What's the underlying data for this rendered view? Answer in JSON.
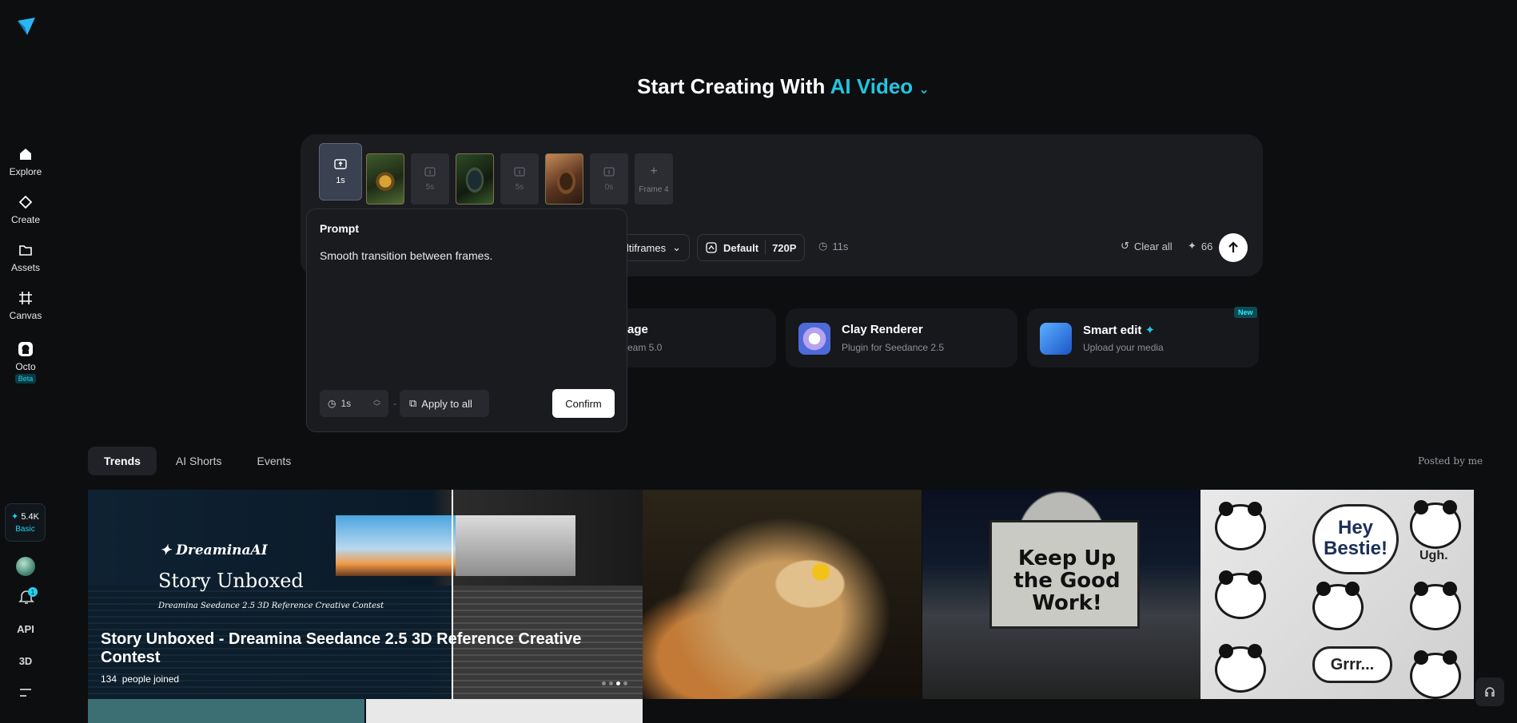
{
  "sidebar": {
    "items": [
      {
        "label": "Explore",
        "icon": "home-icon"
      },
      {
        "label": "Create",
        "icon": "diamond-icon"
      },
      {
        "label": "Assets",
        "icon": "folder-icon"
      },
      {
        "label": "Canvas",
        "icon": "canvas-icon"
      },
      {
        "label": "Octo",
        "icon": "octo-icon",
        "badge": "Beta"
      }
    ],
    "credits": "5.4K",
    "plan": "Basic",
    "notification_count": "1",
    "api_label": "API",
    "three_d_label": "3D"
  },
  "heading": {
    "prefix": "Start Creating With",
    "mode": "AI Video"
  },
  "frames": [
    {
      "label": "1s",
      "type": "active"
    },
    {
      "label": "",
      "type": "image",
      "desc": "serum-bottle"
    },
    {
      "label": "5s",
      "type": "empty"
    },
    {
      "label": "",
      "type": "image",
      "desc": "device"
    },
    {
      "label": "5s",
      "type": "empty"
    },
    {
      "label": "",
      "type": "image",
      "desc": "desk"
    },
    {
      "label": "0s",
      "type": "empty"
    },
    {
      "label": "Frame 4",
      "type": "add"
    }
  ],
  "toolbar": {
    "mode": "ltiframes",
    "quality": "Default",
    "resolution": "720P",
    "duration": "11s",
    "clear_label": "Clear all",
    "cost": "66"
  },
  "popup": {
    "title": "Prompt",
    "text": "Smooth transition between frames.",
    "duration": "1s",
    "apply_label": "Apply to all",
    "confirm_label": "Confirm"
  },
  "cards": [
    {
      "title": "age",
      "subtitle": "eam 5.0"
    },
    {
      "title": "Clay Renderer",
      "subtitle": "Plugin for Seedance 2.5"
    },
    {
      "title": "Smart edit",
      "subtitle": "Upload your media",
      "badge": "New"
    }
  ],
  "tabs": [
    {
      "label": "Trends",
      "active": true
    },
    {
      "label": "AI Shorts",
      "active": false
    },
    {
      "label": "Events",
      "active": false
    }
  ],
  "posted_by": "Posted by me",
  "hero": {
    "brand": "DreaminaAI",
    "big": "Story Unboxed",
    "small": "Dreamina Seedance 2.5 3D Reference Creative Contest",
    "caption": "Story Unboxed - Dreamina Seedance 2.5 3D Reference Creative Contest",
    "joined_count": "134",
    "joined_suffix": "people joined"
  },
  "tile3_text": "Keep Up the Good Work!",
  "tile4": {
    "hey": "Hey Bestie!",
    "ugh": "Ugh.",
    "grrr": "Grrr..."
  },
  "colors": {
    "accent": "#22c5e0",
    "background": "#0d0e10"
  }
}
